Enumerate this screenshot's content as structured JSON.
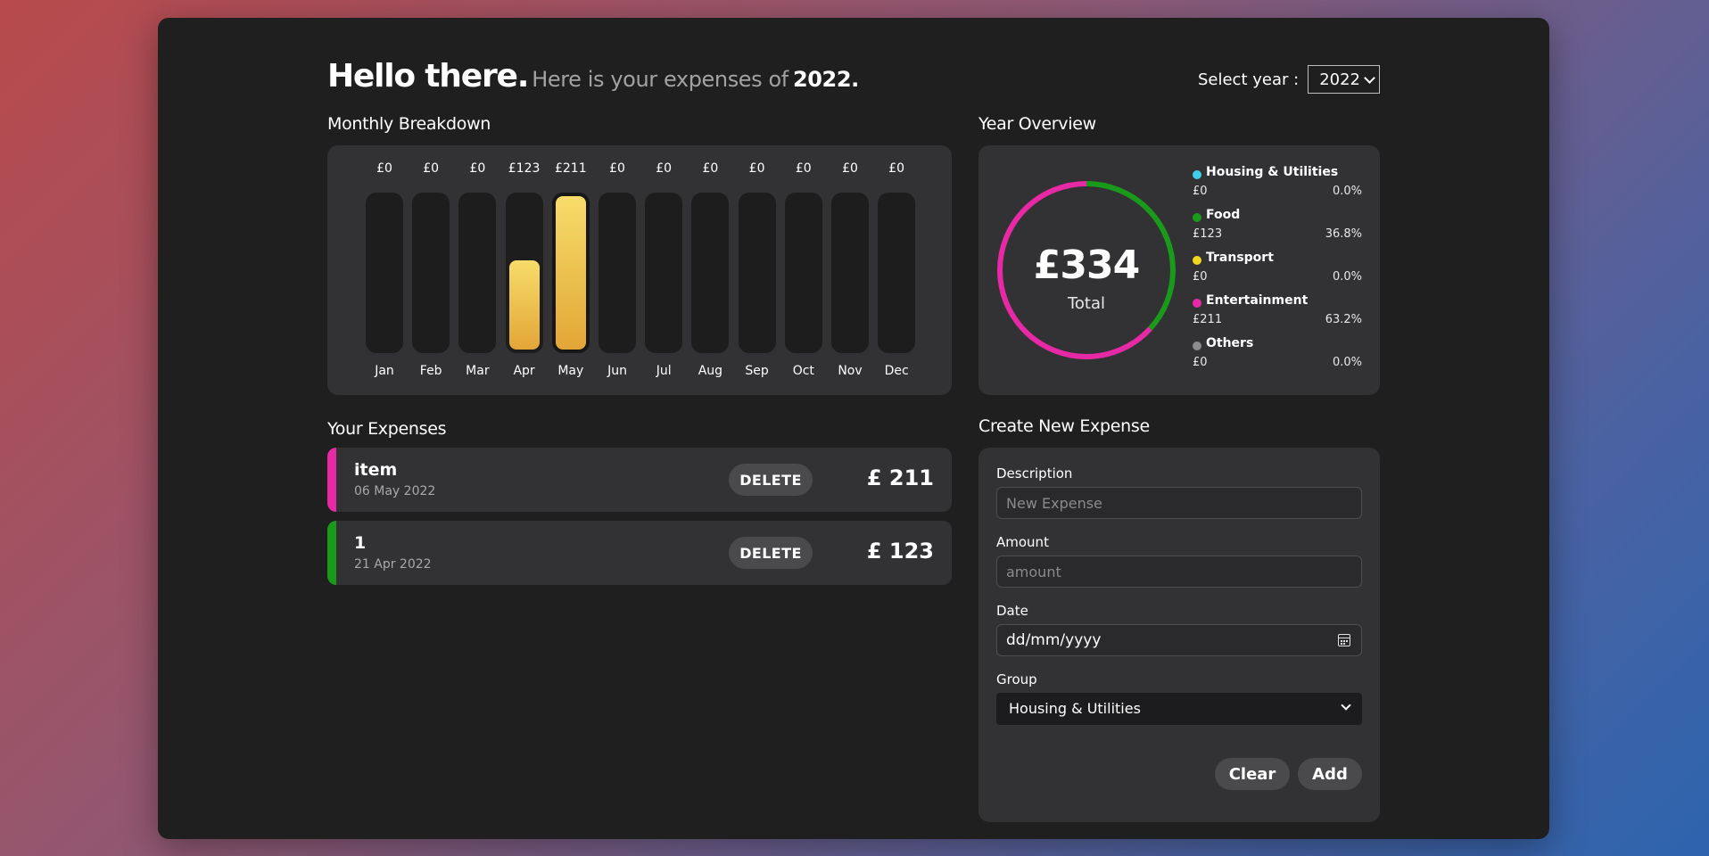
{
  "header": {
    "hello": "Hello there.",
    "subtitle": "Here is your expenses of",
    "year": "2022.",
    "select_year_label": "Select year :",
    "selected_year": "2022"
  },
  "monthly": {
    "title": "Monthly Breakdown",
    "max_value": 211
  },
  "chart_data": {
    "type": "bar",
    "categories": [
      "Jan",
      "Feb",
      "Mar",
      "Apr",
      "May",
      "Jun",
      "Jul",
      "Aug",
      "Sep",
      "Oct",
      "Nov",
      "Dec"
    ],
    "values": [
      0,
      0,
      0,
      123,
      211,
      0,
      0,
      0,
      0,
      0,
      0,
      0
    ],
    "value_labels": [
      "£0",
      "£0",
      "£0",
      "£123",
      "£211",
      "£0",
      "£0",
      "£0",
      "£0",
      "£0",
      "£0",
      "£0"
    ],
    "title": "",
    "xlabel": "",
    "ylabel": ""
  },
  "overview": {
    "title": "Year Overview",
    "total": "£334",
    "total_label": "Total",
    "groups": [
      {
        "name": "Housing & Utilities",
        "amount": "£0",
        "percent": "0.0%",
        "fraction": 0.0,
        "color": "#3fd0e8"
      },
      {
        "name": "Food",
        "amount": "£123",
        "percent": "36.8%",
        "fraction": 0.368,
        "color": "#1a9a1a"
      },
      {
        "name": "Transport",
        "amount": "£0",
        "percent": "0.0%",
        "fraction": 0.0,
        "color": "#f0d81e"
      },
      {
        "name": "Entertainment",
        "amount": "£211",
        "percent": "63.2%",
        "fraction": 0.632,
        "color": "#e829a6"
      },
      {
        "name": "Others",
        "amount": "£0",
        "percent": "0.0%",
        "fraction": 0.0,
        "color": "#8c8c8c"
      }
    ]
  },
  "expenses": {
    "title": "Your Expenses",
    "items": [
      {
        "title": "item",
        "date": "06 May 2022",
        "delete_label": "DELETE",
        "amount": "£ 211",
        "color": "#e829a6"
      },
      {
        "title": "1",
        "date": "21 Apr 2022",
        "delete_label": "DELETE",
        "amount": "£ 123",
        "color": "#1a9a1a"
      }
    ]
  },
  "form": {
    "title": "Create New Expense",
    "description_label": "Description",
    "description_placeholder": "New Expense",
    "amount_label": "Amount",
    "amount_placeholder": "amount",
    "date_label": "Date",
    "date_placeholder": "dd/mm/yyyy",
    "group_label": "Group",
    "group_value": "Housing & Utilities",
    "clear_label": "Clear",
    "add_label": "Add"
  }
}
